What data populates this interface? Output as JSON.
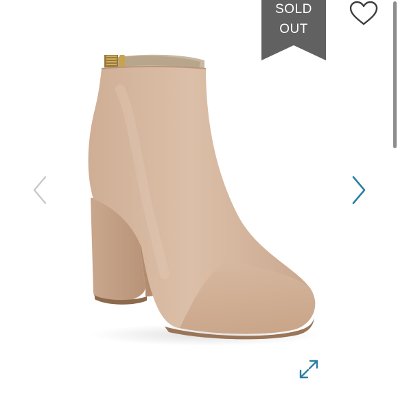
{
  "listing": {
    "status_badge": {
      "line1": "SOLD",
      "line2": "OUT",
      "color": "#616161"
    },
    "colors": {
      "accent": "#2b7fa3",
      "arrow_muted": "#c8c8c8",
      "suede": "#d5b59d"
    }
  },
  "icons": {
    "like": "heart-outline-icon",
    "previous": "chevron-left-icon",
    "next": "chevron-right-icon",
    "expand": "expand-arrows-icon"
  }
}
